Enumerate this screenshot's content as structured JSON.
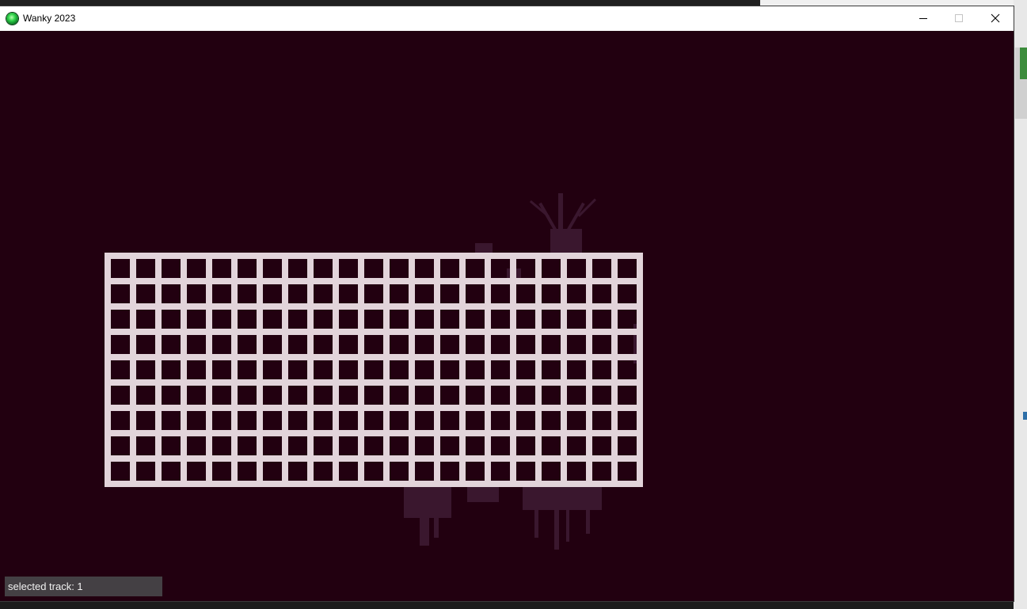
{
  "window": {
    "title": "Wanky 2023",
    "icon": "app-orb-icon",
    "controls": {
      "minimize_icon": "minimize-icon",
      "maximize_icon": "maximize-icon",
      "close_icon": "close-icon"
    }
  },
  "canvas": {
    "background_color": "#220010",
    "grid_line_color": "#e2d4da",
    "grid_columns": 21,
    "grid_rows": 9
  },
  "status_bar": {
    "text": "selected track: 1"
  }
}
